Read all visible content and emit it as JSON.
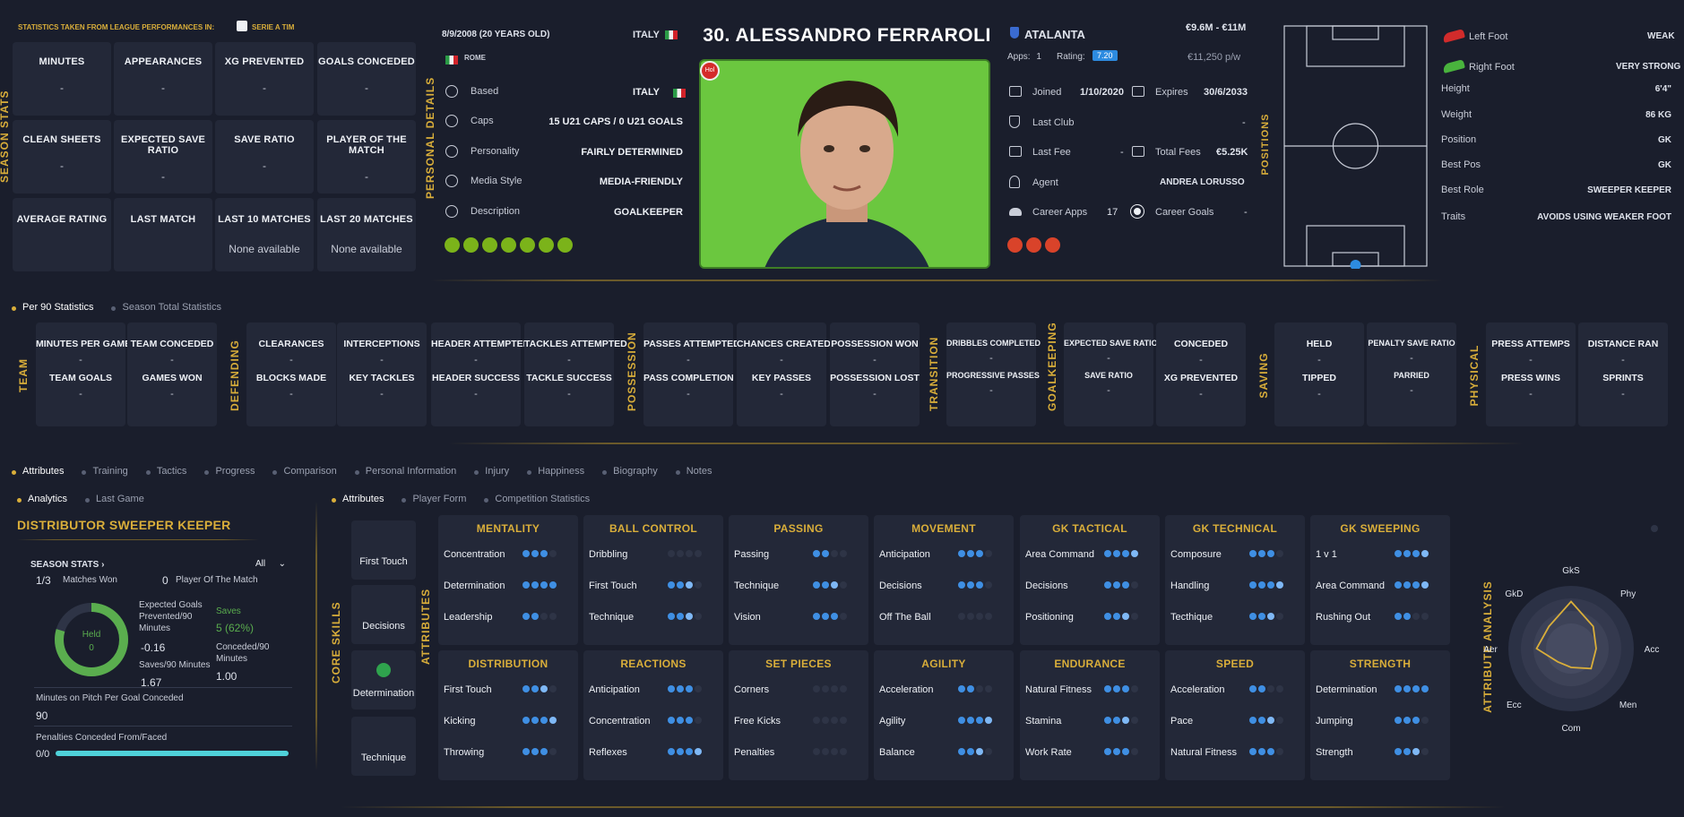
{
  "header": {
    "stats_from": "STATISTICS TAKEN FROM LEAGUE PERFORMANCES IN:",
    "league": "SERIE A TIM"
  },
  "season_stats": {
    "title": "SEASON STATS",
    "cards": [
      {
        "label": "MINUTES",
        "value": "-"
      },
      {
        "label": "APPEARANCES",
        "value": "-"
      },
      {
        "label": "XG PREVENTED",
        "value": "-"
      },
      {
        "label": "GOALS CONCEDED",
        "value": "-"
      },
      {
        "label": "CLEAN SHEETS",
        "value": "-"
      },
      {
        "label": "EXPECTED SAVE RATIO",
        "value": "-"
      },
      {
        "label": "SAVE RATIO",
        "value": "-"
      },
      {
        "label": "PLAYER OF THE MATCH",
        "value": "-"
      },
      {
        "label": "AVERAGE RATING",
        "value": ""
      },
      {
        "label": "LAST MATCH",
        "value": ""
      },
      {
        "label": "LAST 10 MATCHES",
        "value": "None available"
      },
      {
        "label": "LAST 20 MATCHES",
        "value": "None available"
      }
    ]
  },
  "personal": {
    "title": "PERSONAL DETAILS",
    "dob": "8/9/2008 (20 YEARS OLD)",
    "nation": "ITALY",
    "city": "ROME",
    "rows": [
      {
        "k": "Based",
        "v": "ITALY"
      },
      {
        "k": "Caps",
        "v": "15 U21 CAPS / 0 U21 GOALS"
      },
      {
        "k": "Personality",
        "v": "FAIRLY DETERMINED"
      },
      {
        "k": "Media Style",
        "v": "MEDIA-FRIENDLY"
      },
      {
        "k": "Description",
        "v": "GOALKEEPER"
      }
    ]
  },
  "player": {
    "name": "30. ALESSANDRO FERRAROLI",
    "badge": "Hol"
  },
  "club": {
    "name": "ATALANTA",
    "value": "€9.6M - €11M",
    "apps_label": "Apps:",
    "apps": "1",
    "rating_label": "Rating:",
    "rating": "7.20",
    "wage": "€11,250 p/w",
    "joined_label": "Joined",
    "joined": "1/10/2020",
    "expires_label": "Expires",
    "expires": "30/6/2033",
    "last_club_label": "Last Club",
    "last_club": "-",
    "last_fee_label": "Last Fee",
    "last_fee": "-",
    "total_fees_label": "Total Fees",
    "total_fees": "€5.25K",
    "agent_label": "Agent",
    "agent": "ANDREA LORUSSO",
    "career_apps_label": "Career Apps",
    "career_apps": "17",
    "career_goals_label": "Career Goals",
    "career_goals": "-"
  },
  "positions": {
    "title": "POSITIONS"
  },
  "feet": {
    "left_label": "Left Foot",
    "left": "WEAK",
    "right_label": "Right Foot",
    "right": "VERY STRONG"
  },
  "bio": [
    {
      "k": "Height",
      "v": "6'4\""
    },
    {
      "k": "Weight",
      "v": "86 KG"
    },
    {
      "k": "Position",
      "v": "GK"
    },
    {
      "k": "Best Pos",
      "v": "GK"
    },
    {
      "k": "Best Role",
      "v": "SWEEPER KEEPER"
    },
    {
      "k": "Traits",
      "v": "AVOIDS USING WEAKER FOOT"
    }
  ],
  "stat_tabs": [
    "Per 90 Statistics",
    "Season Total Statistics"
  ],
  "stat_groups": {
    "team": "TEAM",
    "defending": "DEFENDING",
    "possession": "POSSESSION",
    "transition": "TRANSITION",
    "goalkeeping": "GOALKEEPING",
    "saving": "SAVING",
    "physical": "PHYSICAL"
  },
  "team_cards": [
    {
      "a": "MINUTES PER GAME",
      "b": "TEAM GOALS"
    },
    {
      "a": "TEAM CONCEDED",
      "b": "GAMES WON"
    },
    {
      "a": "CLEARANCES",
      "b": "BLOCKS MADE"
    },
    {
      "a": "INTERCEPTIONS",
      "b": "KEY TACKLES"
    },
    {
      "a": "HEADER ATTEMPTED",
      "b": "HEADER SUCCESS"
    },
    {
      "a": "TACKLES ATTEMPTED",
      "b": "TACKLE SUCCESS"
    },
    {
      "a": "PASSES ATTEMPTED",
      "b": "PASS COMPLETION"
    },
    {
      "a": "CHANCES CREATED",
      "b": "KEY PASSES"
    },
    {
      "a": "POSSESSION WON",
      "b": "POSSESSION LOST"
    },
    {
      "a": "DRIBBLES COMPLETED",
      "b": "PROGRESSIVE PASSES"
    },
    {
      "a": "EXPECTED SAVE RATIO",
      "b": "SAVE RATIO"
    },
    {
      "a": "CONCEDED",
      "b": "XG PREVENTED"
    },
    {
      "a": "HELD",
      "b": "TIPPED"
    },
    {
      "a": "PENALTY SAVE RATIO",
      "b": "PARRIED"
    },
    {
      "a": "PRESS ATTEMPS",
      "b": "PRESS WINS"
    },
    {
      "a": "DISTANCE RAN",
      "b": "SPRINTS"
    }
  ],
  "dash": "-",
  "main_tabs": [
    "Attributes",
    "Training",
    "Tactics",
    "Progress",
    "Comparison",
    "Personal Information",
    "Injury",
    "Happiness",
    "Biography",
    "Notes"
  ],
  "left_tabs": [
    "Analytics",
    "Last Game"
  ],
  "right_tabs": [
    "Attributes",
    "Player Form",
    "Competition Statistics"
  ],
  "analytics": {
    "role": "DISTRIBUTOR SWEEPER KEEPER",
    "season_stats": "SEASON STATS",
    "filter": "All",
    "matches_won": "1/3",
    "matches_won_label": "Matches Won",
    "potm": "0",
    "potm_label": "Player Of The Match",
    "held_label": "Held",
    "held": "0",
    "xg_label": "Expected Goals Prevented/90 Minutes",
    "xg": "-0.16",
    "saves_label": "Saves",
    "saves": "5 (62%)",
    "saves90_label": "Saves/90 Minutes",
    "saves90": "1.67",
    "conceded90_label": "Conceded/90 Minutes",
    "conceded90": "1.00",
    "mins_goal_label": "Minutes on Pitch Per Goal Conceded",
    "mins_goal": "90",
    "pens_label": "Penalties Conceded From/Faced",
    "pens": "0/0",
    "pens_bar": 1.0
  },
  "core_skills": {
    "title": "CORE SKILLS",
    "items": [
      "First Touch",
      "Decisions",
      "Determination",
      "Technique"
    ]
  },
  "attributes_label": "ATTRIBUTES",
  "attr_groups": [
    {
      "t": "MENTALITY",
      "rows": [
        {
          "n": "Concentration",
          "s": 3
        },
        {
          "n": "Determination",
          "s": 4
        },
        {
          "n": "Leadership",
          "s": 2
        }
      ]
    },
    {
      "t": "BALL CONTROL",
      "rows": [
        {
          "n": "Dribbling",
          "s": 0
        },
        {
          "n": "First Touch",
          "s": 2.5
        },
        {
          "n": "Technique",
          "s": 2.5
        }
      ]
    },
    {
      "t": "PASSING",
      "rows": [
        {
          "n": "Passing",
          "s": 2
        },
        {
          "n": "Technique",
          "s": 2.5
        },
        {
          "n": "Vision",
          "s": 3
        }
      ]
    },
    {
      "t": "MOVEMENT",
      "rows": [
        {
          "n": "Anticipation",
          "s": 3
        },
        {
          "n": "Decisions",
          "s": 3
        },
        {
          "n": "Off The Ball",
          "s": 0
        }
      ]
    },
    {
      "t": "GK TACTICAL",
      "rows": [
        {
          "n": "Area Command",
          "s": 3.5
        },
        {
          "n": "Decisions",
          "s": 3
        },
        {
          "n": "Positioning",
          "s": 2.5
        }
      ]
    },
    {
      "t": "GK TECHNICAL",
      "rows": [
        {
          "n": "Composure",
          "s": 3
        },
        {
          "n": "Handling",
          "s": 3.5
        },
        {
          "n": "Tecthique",
          "s": 2.5
        }
      ]
    },
    {
      "t": "GK SWEEPING",
      "rows": [
        {
          "n": "1 v 1",
          "s": 3.5
        },
        {
          "n": "Area Command",
          "s": 3.5
        },
        {
          "n": "Rushing Out",
          "s": 2
        }
      ]
    },
    {
      "t": "DISTRIBUTION",
      "rows": [
        {
          "n": "First Touch",
          "s": 2.5
        },
        {
          "n": "Kicking",
          "s": 3.5
        },
        {
          "n": "Throwing",
          "s": 3
        }
      ]
    },
    {
      "t": "REACTIONS",
      "rows": [
        {
          "n": "Anticipation",
          "s": 3
        },
        {
          "n": "Concentration",
          "s": 3
        },
        {
          "n": "Reflexes",
          "s": 3.5
        }
      ]
    },
    {
      "t": "SET PIECES",
      "rows": [
        {
          "n": "Corners",
          "s": 0
        },
        {
          "n": "Free Kicks",
          "s": 0
        },
        {
          "n": "Penalties",
          "s": 0
        }
      ]
    },
    {
      "t": "AGILITY",
      "rows": [
        {
          "n": "Acceleration",
          "s": 2
        },
        {
          "n": "Agility",
          "s": 3.5
        },
        {
          "n": "Balance",
          "s": 2.5
        }
      ]
    },
    {
      "t": "ENDURANCE",
      "rows": [
        {
          "n": "Natural Fitness",
          "s": 3
        },
        {
          "n": "Stamina",
          "s": 2.5
        },
        {
          "n": "Work Rate",
          "s": 3
        }
      ]
    },
    {
      "t": "SPEED",
      "rows": [
        {
          "n": "Acceleration",
          "s": 2
        },
        {
          "n": "Pace",
          "s": 2.5
        },
        {
          "n": "Natural Fitness",
          "s": 3
        }
      ]
    },
    {
      "t": "STRENGTH",
      "rows": [
        {
          "n": "Determination",
          "s": 4
        },
        {
          "n": "Jumping",
          "s": 3
        },
        {
          "n": "Strength",
          "s": 2.5
        }
      ]
    }
  ],
  "radar": {
    "title": "ATTRIBUTE ANALYSIS",
    "axes": [
      "GkS",
      "Phy",
      "Acc",
      "Men",
      "Com",
      "Ecc",
      "Aer",
      "GkD"
    ],
    "values": [
      0.75,
      0.5,
      0.4,
      0.45,
      0.3,
      0.3,
      0.55,
      0.5
    ]
  },
  "colors": {
    "gold": "#d9ae3a",
    "accent_blue": "#3f8fe3",
    "pitch_line": "#c9cdd8",
    "held_ring": "#5aad4e",
    "pens_bar": "#4fd1d9"
  }
}
